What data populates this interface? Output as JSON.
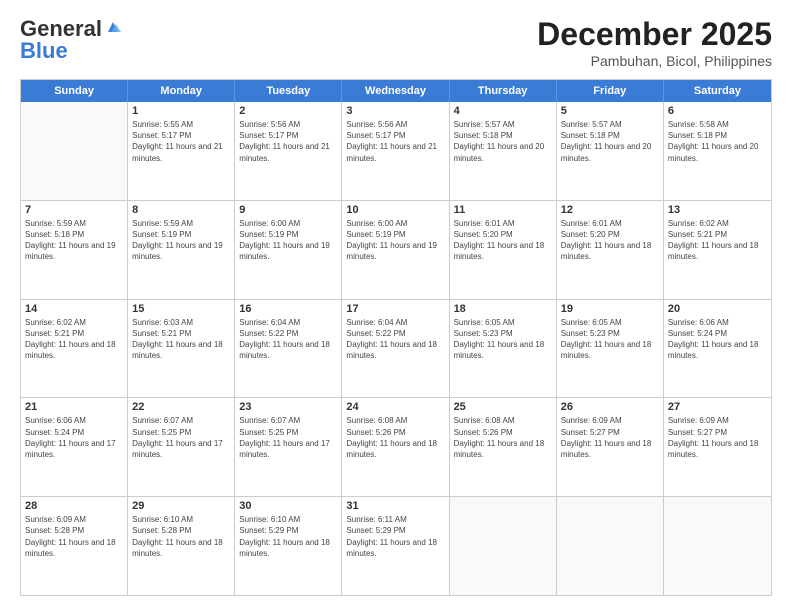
{
  "logo": {
    "general": "General",
    "blue": "Blue"
  },
  "title": "December 2025",
  "subtitle": "Pambuhan, Bicol, Philippines",
  "header_days": [
    "Sunday",
    "Monday",
    "Tuesday",
    "Wednesday",
    "Thursday",
    "Friday",
    "Saturday"
  ],
  "weeks": [
    [
      {
        "day": "",
        "info": ""
      },
      {
        "day": "1",
        "info": "Sunrise: 5:55 AM\nSunset: 5:17 PM\nDaylight: 11 hours and 21 minutes."
      },
      {
        "day": "2",
        "info": "Sunrise: 5:56 AM\nSunset: 5:17 PM\nDaylight: 11 hours and 21 minutes."
      },
      {
        "day": "3",
        "info": "Sunrise: 5:56 AM\nSunset: 5:17 PM\nDaylight: 11 hours and 21 minutes."
      },
      {
        "day": "4",
        "info": "Sunrise: 5:57 AM\nSunset: 5:18 PM\nDaylight: 11 hours and 20 minutes."
      },
      {
        "day": "5",
        "info": "Sunrise: 5:57 AM\nSunset: 5:18 PM\nDaylight: 11 hours and 20 minutes."
      },
      {
        "day": "6",
        "info": "Sunrise: 5:58 AM\nSunset: 5:18 PM\nDaylight: 11 hours and 20 minutes."
      }
    ],
    [
      {
        "day": "7",
        "info": "Sunrise: 5:59 AM\nSunset: 5:18 PM\nDaylight: 11 hours and 19 minutes."
      },
      {
        "day": "8",
        "info": "Sunrise: 5:59 AM\nSunset: 5:19 PM\nDaylight: 11 hours and 19 minutes."
      },
      {
        "day": "9",
        "info": "Sunrise: 6:00 AM\nSunset: 5:19 PM\nDaylight: 11 hours and 19 minutes."
      },
      {
        "day": "10",
        "info": "Sunrise: 6:00 AM\nSunset: 5:19 PM\nDaylight: 11 hours and 19 minutes."
      },
      {
        "day": "11",
        "info": "Sunrise: 6:01 AM\nSunset: 5:20 PM\nDaylight: 11 hours and 18 minutes."
      },
      {
        "day": "12",
        "info": "Sunrise: 6:01 AM\nSunset: 5:20 PM\nDaylight: 11 hours and 18 minutes."
      },
      {
        "day": "13",
        "info": "Sunrise: 6:02 AM\nSunset: 5:21 PM\nDaylight: 11 hours and 18 minutes."
      }
    ],
    [
      {
        "day": "14",
        "info": "Sunrise: 6:02 AM\nSunset: 5:21 PM\nDaylight: 11 hours and 18 minutes."
      },
      {
        "day": "15",
        "info": "Sunrise: 6:03 AM\nSunset: 5:21 PM\nDaylight: 11 hours and 18 minutes."
      },
      {
        "day": "16",
        "info": "Sunrise: 6:04 AM\nSunset: 5:22 PM\nDaylight: 11 hours and 18 minutes."
      },
      {
        "day": "17",
        "info": "Sunrise: 6:04 AM\nSunset: 5:22 PM\nDaylight: 11 hours and 18 minutes."
      },
      {
        "day": "18",
        "info": "Sunrise: 6:05 AM\nSunset: 5:23 PM\nDaylight: 11 hours and 18 minutes."
      },
      {
        "day": "19",
        "info": "Sunrise: 6:05 AM\nSunset: 5:23 PM\nDaylight: 11 hours and 18 minutes."
      },
      {
        "day": "20",
        "info": "Sunrise: 6:06 AM\nSunset: 5:24 PM\nDaylight: 11 hours and 18 minutes."
      }
    ],
    [
      {
        "day": "21",
        "info": "Sunrise: 6:06 AM\nSunset: 5:24 PM\nDaylight: 11 hours and 17 minutes."
      },
      {
        "day": "22",
        "info": "Sunrise: 6:07 AM\nSunset: 5:25 PM\nDaylight: 11 hours and 17 minutes."
      },
      {
        "day": "23",
        "info": "Sunrise: 6:07 AM\nSunset: 5:25 PM\nDaylight: 11 hours and 17 minutes."
      },
      {
        "day": "24",
        "info": "Sunrise: 6:08 AM\nSunset: 5:26 PM\nDaylight: 11 hours and 18 minutes."
      },
      {
        "day": "25",
        "info": "Sunrise: 6:08 AM\nSunset: 5:26 PM\nDaylight: 11 hours and 18 minutes."
      },
      {
        "day": "26",
        "info": "Sunrise: 6:09 AM\nSunset: 5:27 PM\nDaylight: 11 hours and 18 minutes."
      },
      {
        "day": "27",
        "info": "Sunrise: 6:09 AM\nSunset: 5:27 PM\nDaylight: 11 hours and 18 minutes."
      }
    ],
    [
      {
        "day": "28",
        "info": "Sunrise: 6:09 AM\nSunset: 5:28 PM\nDaylight: 11 hours and 18 minutes."
      },
      {
        "day": "29",
        "info": "Sunrise: 6:10 AM\nSunset: 5:28 PM\nDaylight: 11 hours and 18 minutes."
      },
      {
        "day": "30",
        "info": "Sunrise: 6:10 AM\nSunset: 5:29 PM\nDaylight: 11 hours and 18 minutes."
      },
      {
        "day": "31",
        "info": "Sunrise: 6:11 AM\nSunset: 5:29 PM\nDaylight: 11 hours and 18 minutes."
      },
      {
        "day": "",
        "info": ""
      },
      {
        "day": "",
        "info": ""
      },
      {
        "day": "",
        "info": ""
      }
    ]
  ]
}
